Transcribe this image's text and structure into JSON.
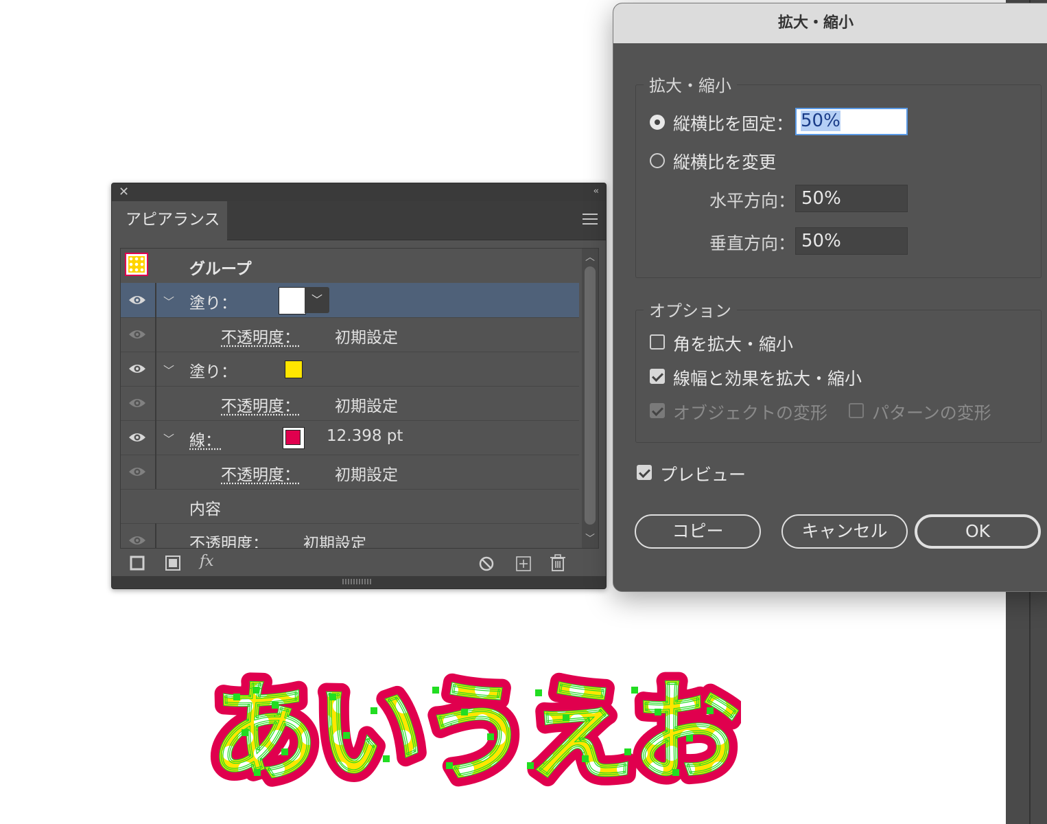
{
  "appearance_panel": {
    "close": "✕",
    "collapse": "‹‹",
    "tab": "アピアランス",
    "group_label": "グループ",
    "rows": [
      {
        "label": "塗り：",
        "kind": "fill",
        "swatch": "#ffffff"
      },
      {
        "label": "不透明度：",
        "value": "初期設定"
      },
      {
        "label": "塗り：",
        "kind": "fill",
        "swatch": "#ffe600"
      },
      {
        "label": "不透明度：",
        "value": "初期設定"
      },
      {
        "label": "線：",
        "kind": "stroke",
        "swatch": "#e0004e",
        "value": "12.398 pt"
      },
      {
        "label": "不透明度：",
        "value": "初期設定"
      },
      {
        "label": "内容"
      },
      {
        "label": "不透明度：",
        "value": "初期設定"
      }
    ],
    "footer_icons": [
      "new-stroke-icon",
      "new-fill-icon",
      "fx-icon",
      "clear-appearance-icon",
      "duplicate-item-icon",
      "delete-icon"
    ],
    "fx": "fx"
  },
  "scale_dialog": {
    "title": "拡大・縮小",
    "scale_section": "拡大・縮小",
    "uniform_label": "縦横比を固定：",
    "uniform_value": "50%",
    "nonuniform_label": "縦横比を変更",
    "horizontal_label": "水平方向：",
    "horizontal_value": "50%",
    "vertical_label": "垂直方向：",
    "vertical_value": "50%",
    "options_section": "オプション",
    "scale_corners": "角を拡大・縮小",
    "scale_strokes": "線幅と効果を拡大・縮小",
    "transform_objects": "オブジェクトの変形",
    "transform_patterns": "パターンの変形",
    "preview": "プレビュー",
    "copy_button": "コピー",
    "cancel_button": "キャンセル",
    "ok_button": "OK"
  },
  "artwork": {
    "text": "あいうえお",
    "fill_color": "#ffe600",
    "stroke_color": "#e0004e",
    "anchor_color": "#22dd22"
  }
}
